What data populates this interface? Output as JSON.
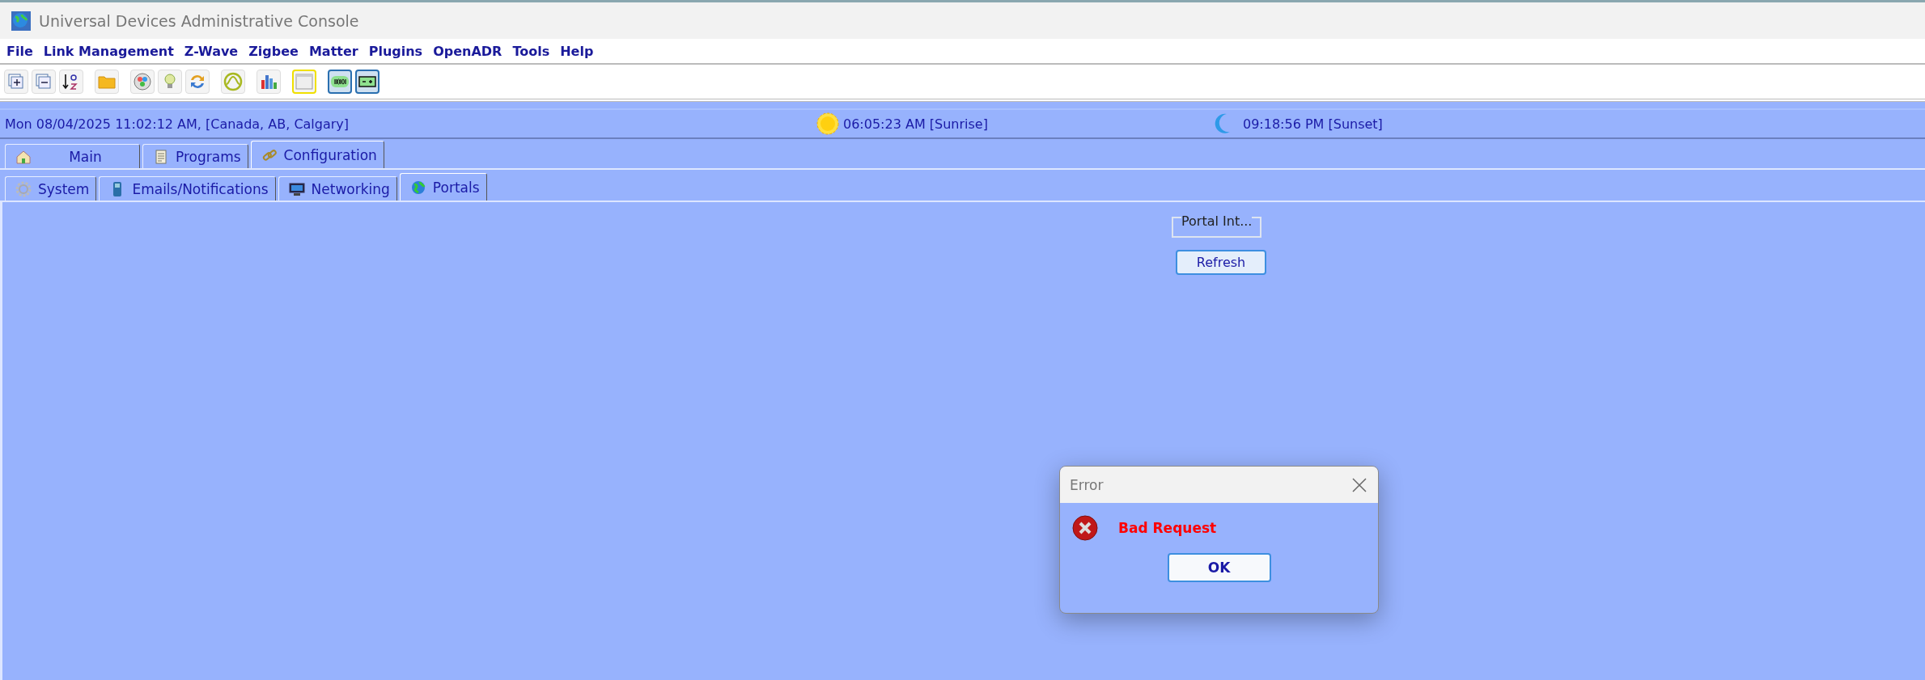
{
  "window": {
    "title": "Universal Devices Administrative Console"
  },
  "menu": [
    "File",
    "Link Management",
    "Z-Wave",
    "Zigbee",
    "Matter",
    "Plugins",
    "OpenADR",
    "Tools",
    "Help"
  ],
  "toolbar": [
    {
      "kind": "expand",
      "on": false
    },
    {
      "kind": "collapse",
      "on": false
    },
    {
      "kind": "sort",
      "on": false
    },
    {
      "kind": "folder",
      "on": false
    },
    {
      "kind": "network",
      "on": false
    },
    {
      "kind": "bulb",
      "on": false
    },
    {
      "kind": "sync",
      "on": false
    },
    {
      "kind": "wave",
      "on": false
    },
    {
      "kind": "chart",
      "on": false
    },
    {
      "kind": "window",
      "on": false
    },
    {
      "kind": "binary",
      "on": true
    },
    {
      "kind": "battery",
      "on": true
    }
  ],
  "status": {
    "datetime": "Mon 08/04/2025 11:02:12 AM,  [Canada, AB, Calgary]",
    "sunrise": "06:05:23 AM [Sunrise]",
    "sunset": "09:18:56 PM [Sunset]"
  },
  "tabs": [
    {
      "label": "Main",
      "kind": "home",
      "selected": false
    },
    {
      "label": "Programs",
      "kind": "notepad",
      "selected": false
    },
    {
      "label": "Configuration",
      "kind": "link",
      "selected": true
    }
  ],
  "subtabs": [
    {
      "label": "System",
      "kind": "gear",
      "selected": false
    },
    {
      "label": "Emails/Notifications",
      "kind": "phone",
      "selected": false
    },
    {
      "label": "Networking",
      "kind": "monitor",
      "selected": false
    },
    {
      "label": "Portals",
      "kind": "globe",
      "selected": true
    }
  ],
  "portal": {
    "group_title": "Portal Int...",
    "button": "Refresh"
  },
  "dialog": {
    "title": "Error",
    "message": "Bad Request",
    "button": "OK"
  }
}
